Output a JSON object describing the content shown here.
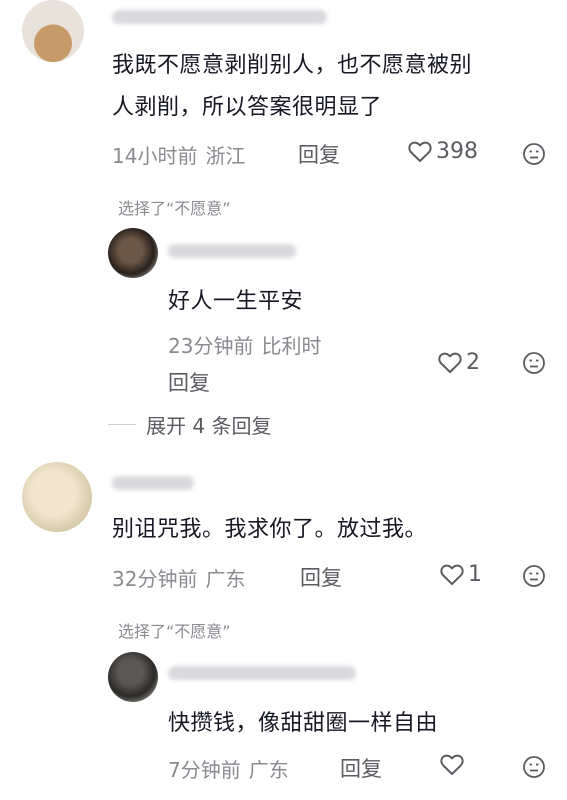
{
  "comments": [
    {
      "content_line1": "我既不愿意剥削别人，也不愿意被别",
      "content_line2": "人剥削，所以答案很明显了",
      "time": "14小时前",
      "location": "浙江",
      "reply_label": "回复",
      "likes": "398"
    },
    {
      "tag": "选择了“不愿意”",
      "content": "好人一生平安",
      "time": "23分钟前",
      "location": "比利时",
      "reply_label": "回复",
      "likes": "2"
    },
    {
      "expand_label": "展开 4 条回复"
    },
    {
      "content": "别诅咒我。我求你了。放过我。",
      "time": "32分钟前",
      "location": "广东",
      "reply_label": "回复",
      "likes": "1"
    },
    {
      "tag": "选择了“不愿意”",
      "content": "快攒钱，像甜甜圈一样自由",
      "time": "7分钟前",
      "location": "广东",
      "reply_label": "回复",
      "likes": ""
    }
  ],
  "colors": {
    "text_primary": "#161823",
    "text_secondary": "#8a8b91",
    "text_action": "#5b5c62"
  },
  "icons": [
    "heart-outline-icon",
    "dislike-face-icon"
  ]
}
